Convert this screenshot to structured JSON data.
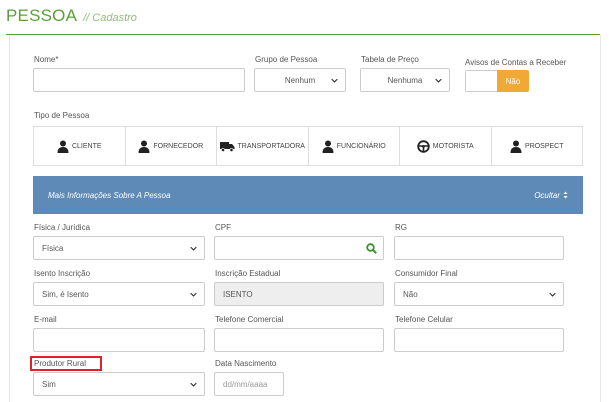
{
  "header": {
    "title": "PESSOA",
    "subtitle": "// Cadastro"
  },
  "top": {
    "nome_label": "Nome*",
    "grupo_label": "Grupo de Pessoa",
    "grupo_value": "Nenhum",
    "tabela_label": "Tabela de Preço",
    "tabela_value": "Nenhuma",
    "avisos_label": "Avisos de Contas a Receber",
    "avisos_value": "Não"
  },
  "tipo": {
    "label": "Tipo de Pessoa",
    "options": [
      {
        "label": "CLIENTE",
        "icon": "person-icon"
      },
      {
        "label": "FORNECEDOR",
        "icon": "person-icon"
      },
      {
        "label": "TRANSPORTADORA",
        "icon": "truck-icon"
      },
      {
        "label": "FUNCIONÁRIO",
        "icon": "person-icon"
      },
      {
        "label": "MOTORISTA",
        "icon": "steering-wheel-icon"
      },
      {
        "label": "PROSPECT",
        "icon": "person-icon"
      }
    ]
  },
  "more": {
    "title": "Mais Informações Sobre A Pessoa",
    "toggle_label": "Ocultar"
  },
  "form": {
    "fisica_label": "Física / Jurídica",
    "fisica_value": "Física",
    "cpf_label": "CPF",
    "rg_label": "RG",
    "isento_label": "Isento Inscrição",
    "isento_value": "Sim, é Isento",
    "ie_label": "Inscrição Estadual",
    "ie_value": "ISENTO",
    "consumidor_label": "Consumidor Final",
    "consumidor_value": "Não",
    "email_label": "E-mail",
    "tel_com_label": "Telefone Comercial",
    "tel_cel_label": "Telefone Celular",
    "produtor_label": "Produtor Rural",
    "produtor_value": "Sim",
    "nascimento_label": "Data Nascimento",
    "nascimento_placeholder": "dd/mm/aaaa"
  },
  "colors": {
    "green": "#5aa03c",
    "blue_bar": "#5d8ab6",
    "orange": "#f0a936",
    "highlight": "#e0202a"
  }
}
